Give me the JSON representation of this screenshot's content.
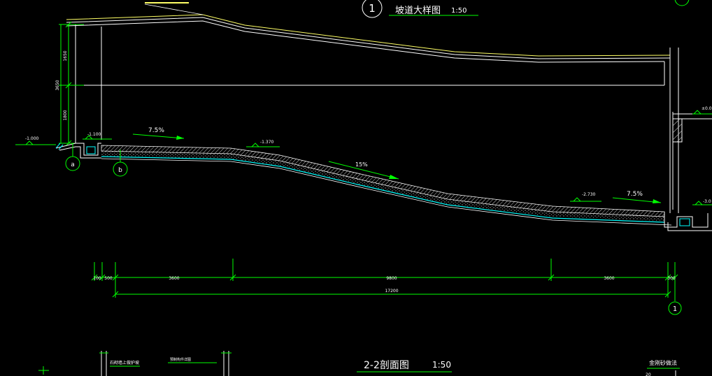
{
  "titles": {
    "detail_circle_num": "1",
    "detail_title": "坡道大样图",
    "detail_scale": "1:50",
    "section_title": "2-2剖面图",
    "section_scale": "1:50",
    "bottom_right_label": "金刚砂做法",
    "bottom_left_note": "石砌墙上做护坡",
    "bottom_mid_note": "预制构件详图"
  },
  "vertical_dims": {
    "total": "3650",
    "upper": "1650",
    "lower": "1800"
  },
  "elevations": {
    "left_ground": "-1.000",
    "ramp_top": "-1.100",
    "ramp_upper": "-1.370",
    "ramp_lower": "-2.730",
    "right_top": "±0.0",
    "right_low": "-3.0"
  },
  "slopes": {
    "s1": "7.5%",
    "s2": "15%",
    "s3": "7.5%"
  },
  "axis_marks": {
    "a": "a",
    "b": "b",
    "end": "1"
  },
  "horizontal_dims": [
    "100",
    "500",
    "3600",
    "9800",
    "3600",
    "300"
  ],
  "total_length": "17200",
  "corner_number": "20",
  "colors": {
    "background": "#000000",
    "line_white": "#ffffff",
    "line_green": "#00ff00",
    "line_cyan": "#00ffff",
    "line_yellow": "#ffff66",
    "text_main": "#ffffff",
    "hatch": "#bbbbbb"
  }
}
